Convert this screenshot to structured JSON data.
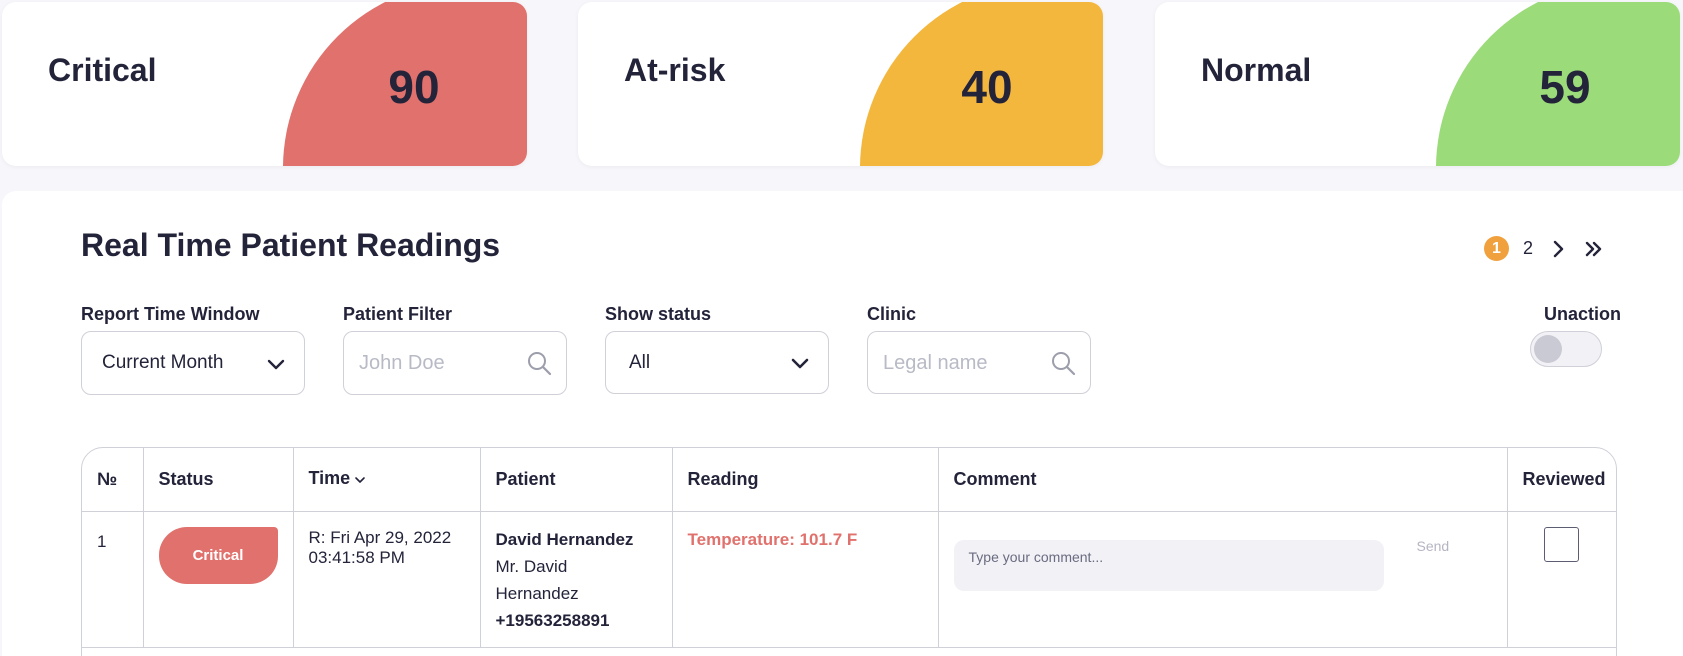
{
  "cards": [
    {
      "title": "Critical",
      "value": "90",
      "color": "#e0716c"
    },
    {
      "title": "At-risk",
      "value": "40",
      "color": "#f4b73e"
    },
    {
      "title": "Normal",
      "value": "59",
      "color": "#9bdb7a"
    }
  ],
  "panel": {
    "title": "Real Time Patient Readings",
    "pagination": {
      "active_page": "1",
      "pages": [
        "1",
        "2"
      ],
      "icons": [
        "chevron-right-icon",
        "double-chevron-right-icon"
      ]
    }
  },
  "filters": {
    "report_window": {
      "label": "Report Time Window",
      "value": "Current Month"
    },
    "patient": {
      "label": "Patient Filter",
      "placeholder": "John Doe"
    },
    "status": {
      "label": "Show status",
      "value": "All"
    },
    "clinic": {
      "label": "Clinic",
      "placeholder": "Legal name"
    },
    "unaction": {
      "label": "Unaction",
      "checked": false
    }
  },
  "table": {
    "columns": [
      "№",
      "Status",
      "Time",
      "Patient",
      "Reading",
      "Comment",
      "Reviewed"
    ],
    "rows": [
      {
        "number": "1",
        "status": "Critical",
        "time_line1": "R: Fri Apr 29, 2022",
        "time_line2": "03:41:58 PM",
        "patient_name": "David Hernandez",
        "patient_title_line1": "Mr. David",
        "patient_title_line2": "Hernandez",
        "patient_phone": "+19563258891",
        "reading": "Temperature: 101.7 F",
        "comment_placeholder": "Type your comment...",
        "send_label": "Send",
        "reviewed": false
      }
    ]
  },
  "colors": {
    "accent": "#f0a03c",
    "critical": "#e0716c",
    "at_risk": "#f4b73e",
    "normal": "#9bdb7a"
  }
}
